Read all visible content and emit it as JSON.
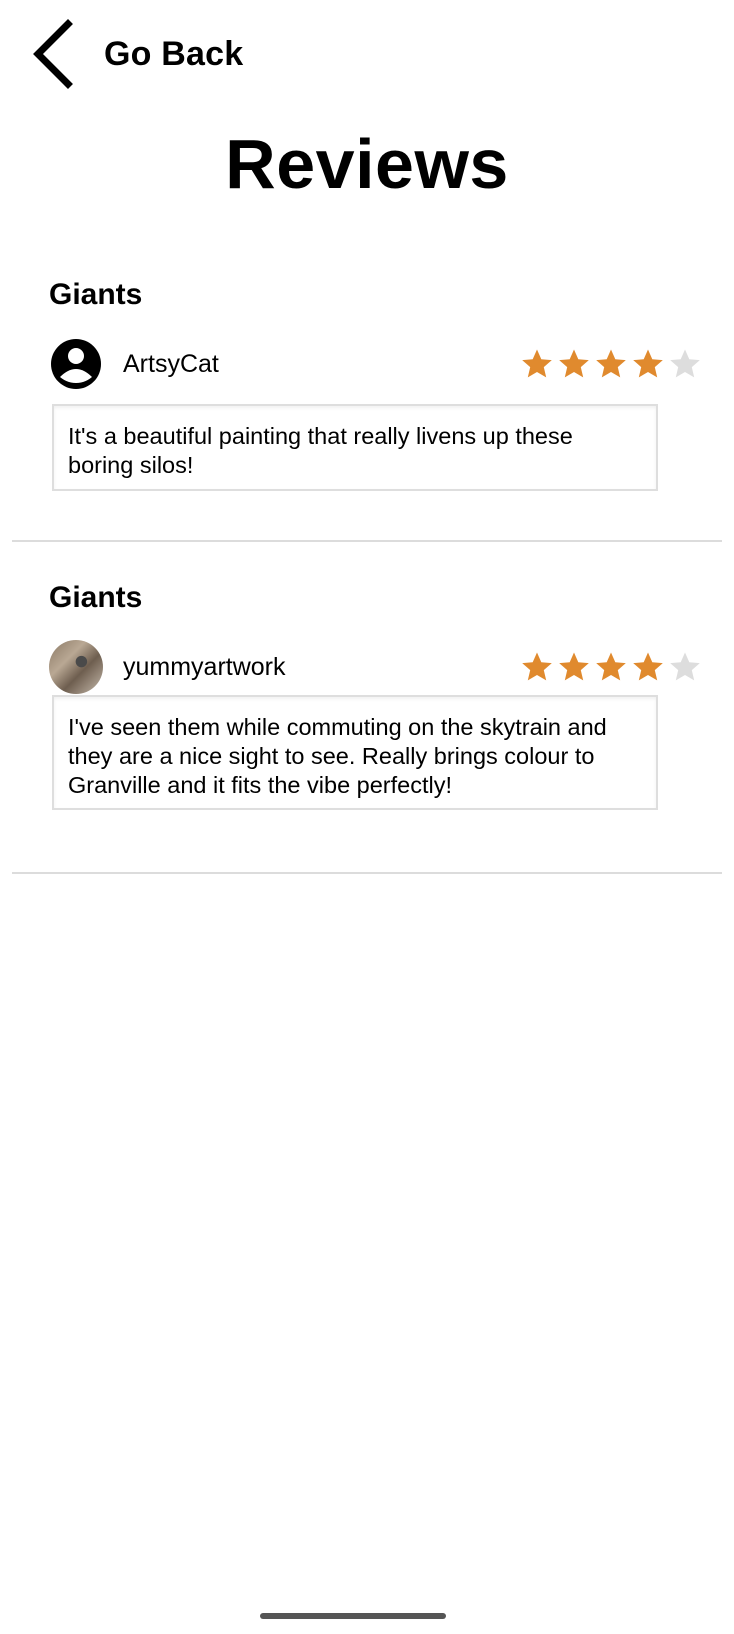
{
  "header": {
    "back_label": "Go Back",
    "back_icon": "chevron-left-icon"
  },
  "page": {
    "title": "Reviews"
  },
  "colors": {
    "star_filled": "#E08A2E",
    "star_empty": "#DDDDDD",
    "divider": "#DCDCDC"
  },
  "reviews": [
    {
      "title": "Giants",
      "username": "ArtsyCat",
      "avatar": "user-circle-icon",
      "rating": 4,
      "max_rating": 5,
      "text": "It's a beautiful painting that really livens up these boring silos!"
    },
    {
      "title": "Giants",
      "username": "yummyartwork",
      "avatar": "profile-photo",
      "rating": 4,
      "max_rating": 5,
      "text": "I've seen them while commuting on the skytrain and they are a nice sight to see. Really brings colour to Granville and it fits the vibe perfectly!"
    }
  ]
}
